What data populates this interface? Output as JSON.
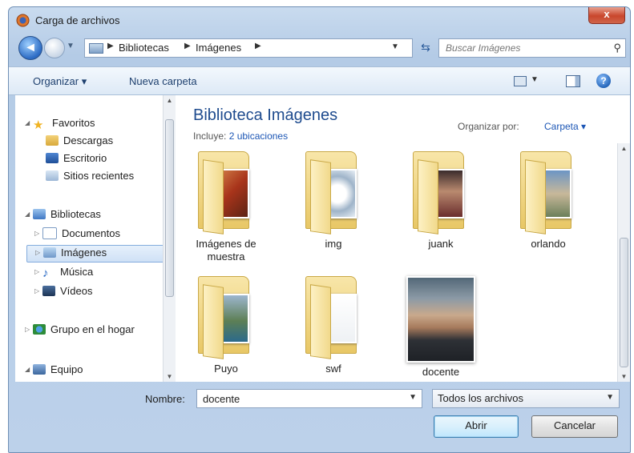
{
  "window": {
    "title": "Carga de archivos",
    "close_label": "x"
  },
  "nav": {
    "breadcrumbs": [
      "Bibliotecas",
      "Imágenes"
    ],
    "search_placeholder": "Buscar Imágenes"
  },
  "toolbar": {
    "organize": "Organizar ▾",
    "new_folder": "Nueva carpeta"
  },
  "sidebar": {
    "items": [
      {
        "label": "Favoritos",
        "icon": "star-icon",
        "level": 0
      },
      {
        "label": "Descargas",
        "icon": "downloads-folder-icon",
        "level": 1
      },
      {
        "label": "Escritorio",
        "icon": "desktop-icon",
        "level": 1
      },
      {
        "label": "Sitios recientes",
        "icon": "recent-places-icon",
        "level": 1
      },
      {
        "label": "Bibliotecas",
        "icon": "libraries-icon",
        "level": 0
      },
      {
        "label": "Documentos",
        "icon": "documents-icon",
        "level": 1
      },
      {
        "label": "Imágenes",
        "icon": "pictures-icon",
        "level": 1,
        "selected": true
      },
      {
        "label": "Música",
        "icon": "music-icon",
        "level": 1
      },
      {
        "label": "Vídeos",
        "icon": "videos-icon",
        "level": 1
      },
      {
        "label": "Grupo en el hogar",
        "icon": "homegroup-icon",
        "level": 0
      },
      {
        "label": "Equipo",
        "icon": "computer-icon",
        "level": 0
      }
    ]
  },
  "content": {
    "title": "Biblioteca Imágenes",
    "includes_label": "Incluye:",
    "includes_link": "2 ubicaciones",
    "arrange_label": "Organizar por:",
    "arrange_value": "Carpeta ▾",
    "items": [
      {
        "label": "Imágenes de muestra",
        "type": "folder"
      },
      {
        "label": "img",
        "type": "folder"
      },
      {
        "label": "juank",
        "type": "folder"
      },
      {
        "label": "orlando",
        "type": "folder"
      },
      {
        "label": "Puyo",
        "type": "folder"
      },
      {
        "label": "swf",
        "type": "folder"
      },
      {
        "label": "docente",
        "type": "photo"
      }
    ]
  },
  "bottom": {
    "filename_label": "Nombre:",
    "filename_value": "docente",
    "filetype_value": "Todos los archivos",
    "open_label": "Abrir",
    "cancel_label": "Cancelar"
  }
}
